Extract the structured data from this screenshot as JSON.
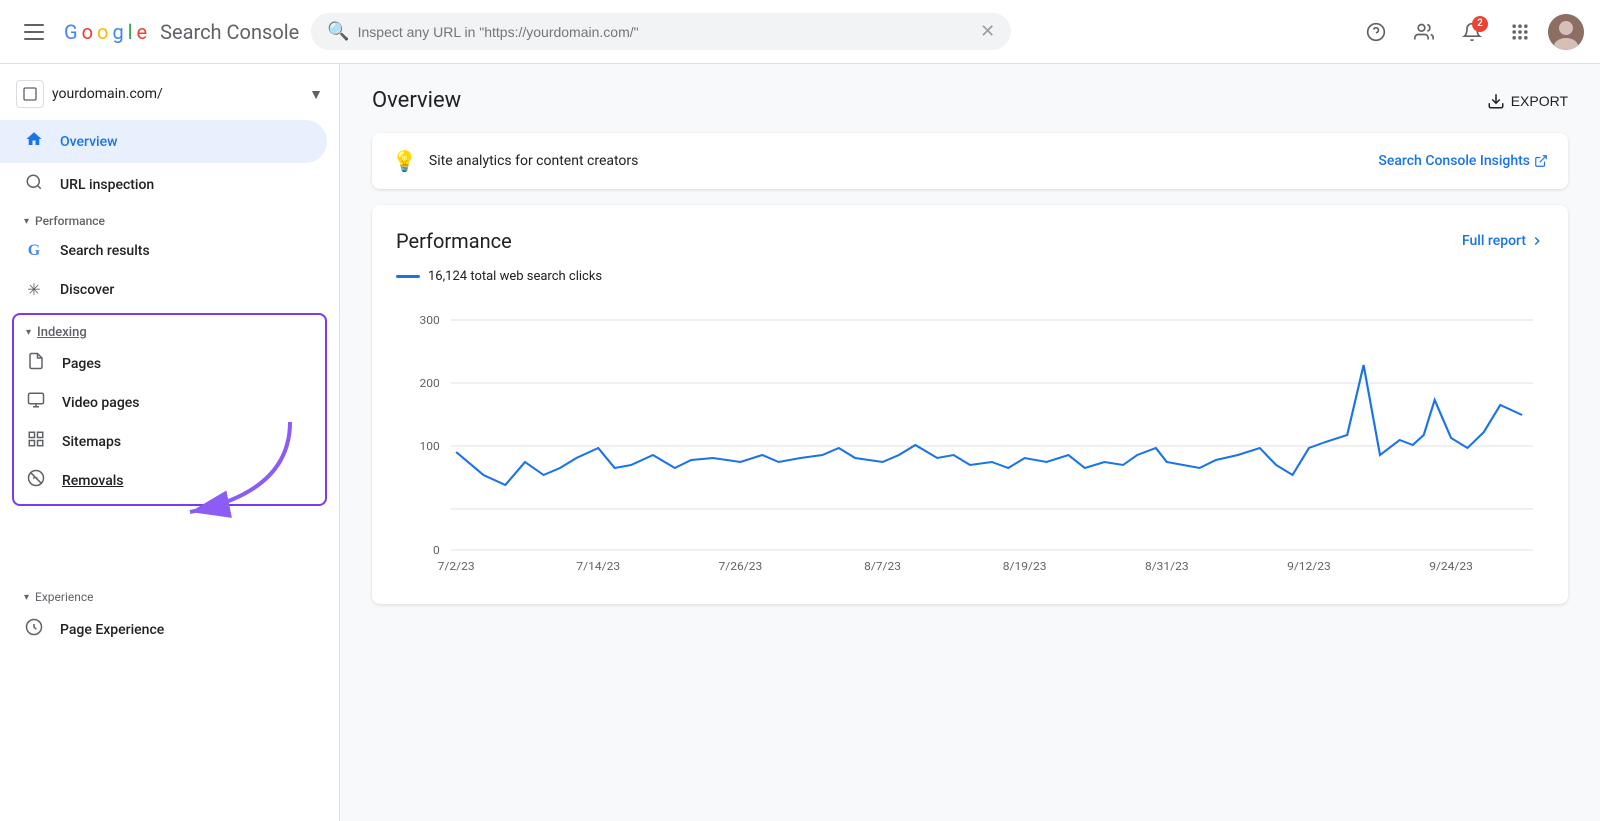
{
  "topbar": {
    "logo": {
      "g1": "G",
      "o1": "o",
      "o2": "o",
      "g2": "g",
      "l": "l",
      "e": "e",
      "product": "Search Console"
    },
    "search_placeholder": "Inspect any URL in \"https://yourdomain.com/\"",
    "notification_count": "2",
    "export_label": "EXPORT"
  },
  "sidebar": {
    "domain": "yourdomain.com/",
    "nav_items": [
      {
        "id": "overview",
        "label": "Overview",
        "icon": "🏠",
        "active": true
      },
      {
        "id": "url-inspection",
        "label": "URL inspection",
        "icon": "🔍",
        "active": false
      }
    ],
    "performance_section": {
      "label": "Performance",
      "items": [
        {
          "id": "search-results",
          "label": "Search results",
          "icon": "G"
        },
        {
          "id": "discover",
          "label": "Discover",
          "icon": "✳"
        }
      ]
    },
    "indexing_section": {
      "label": "Indexing",
      "items": [
        {
          "id": "pages",
          "label": "Pages"
        },
        {
          "id": "video-pages",
          "label": "Video pages"
        },
        {
          "id": "sitemaps",
          "label": "Sitemaps"
        },
        {
          "id": "removals",
          "label": "Removals"
        }
      ]
    },
    "experience_section": {
      "label": "Experience",
      "items": [
        {
          "id": "page-experience",
          "label": "Page Experience"
        }
      ]
    }
  },
  "main": {
    "title": "Overview",
    "export_label": "EXPORT",
    "banner": {
      "text": "Site analytics for content creators",
      "link_text": "Search Console Insights"
    },
    "performance": {
      "title": "Performance",
      "full_report": "Full report",
      "legend_text": "16,124 total web search clicks",
      "y_labels": [
        "300",
        "200",
        "100",
        "0"
      ],
      "x_labels": [
        "7/2/23",
        "7/14/23",
        "7/26/23",
        "8/7/23",
        "8/19/23",
        "8/31/23",
        "9/12/23",
        "9/24/23"
      ]
    }
  }
}
